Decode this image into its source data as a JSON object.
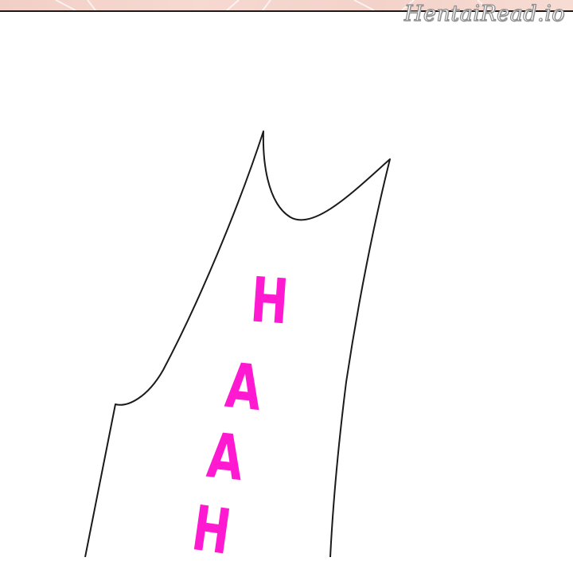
{
  "watermark": {
    "text": "HentaiRead.io"
  },
  "sfx": {
    "text": "HAAH",
    "letters": [
      "H",
      "A",
      "A",
      "H"
    ],
    "color": "#ff1ad2"
  },
  "colors": {
    "background": "#ffffff",
    "top_strip": "#f4d4cb",
    "ink": "#1a1a1a"
  }
}
